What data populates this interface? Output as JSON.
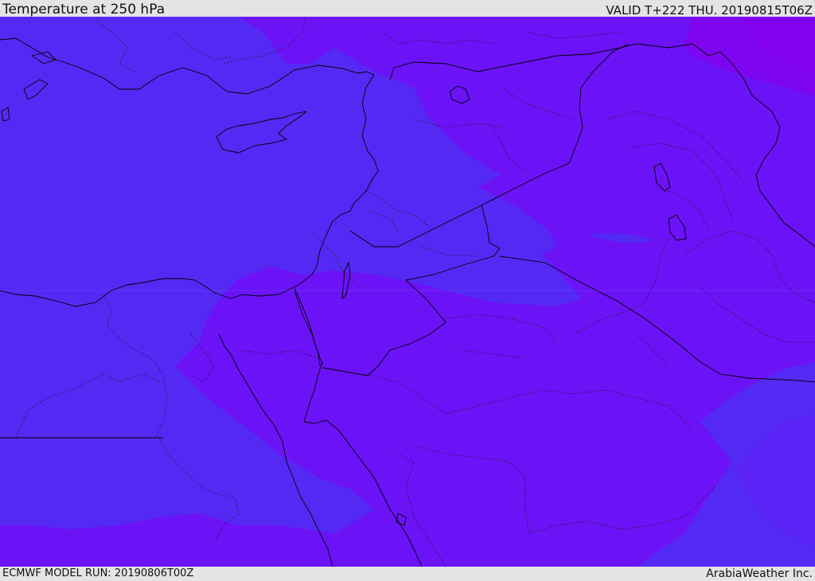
{
  "header": {
    "title": "Temperature at 250 hPa",
    "valid": "VALID T+222 THU. 20190815T06Z"
  },
  "footer": {
    "model_run": "ECMWF MODEL RUN: 20190806T00Z",
    "credit": "ArabiaWeather Inc."
  },
  "map": {
    "variable": "temperature",
    "level": "250 hPa",
    "colors": {
      "cold_band": "#6b13f6",
      "mid_band": "#5529f4",
      "coldest_band": "#7d05f0",
      "coastline": "#000000",
      "border": "#000000"
    }
  }
}
